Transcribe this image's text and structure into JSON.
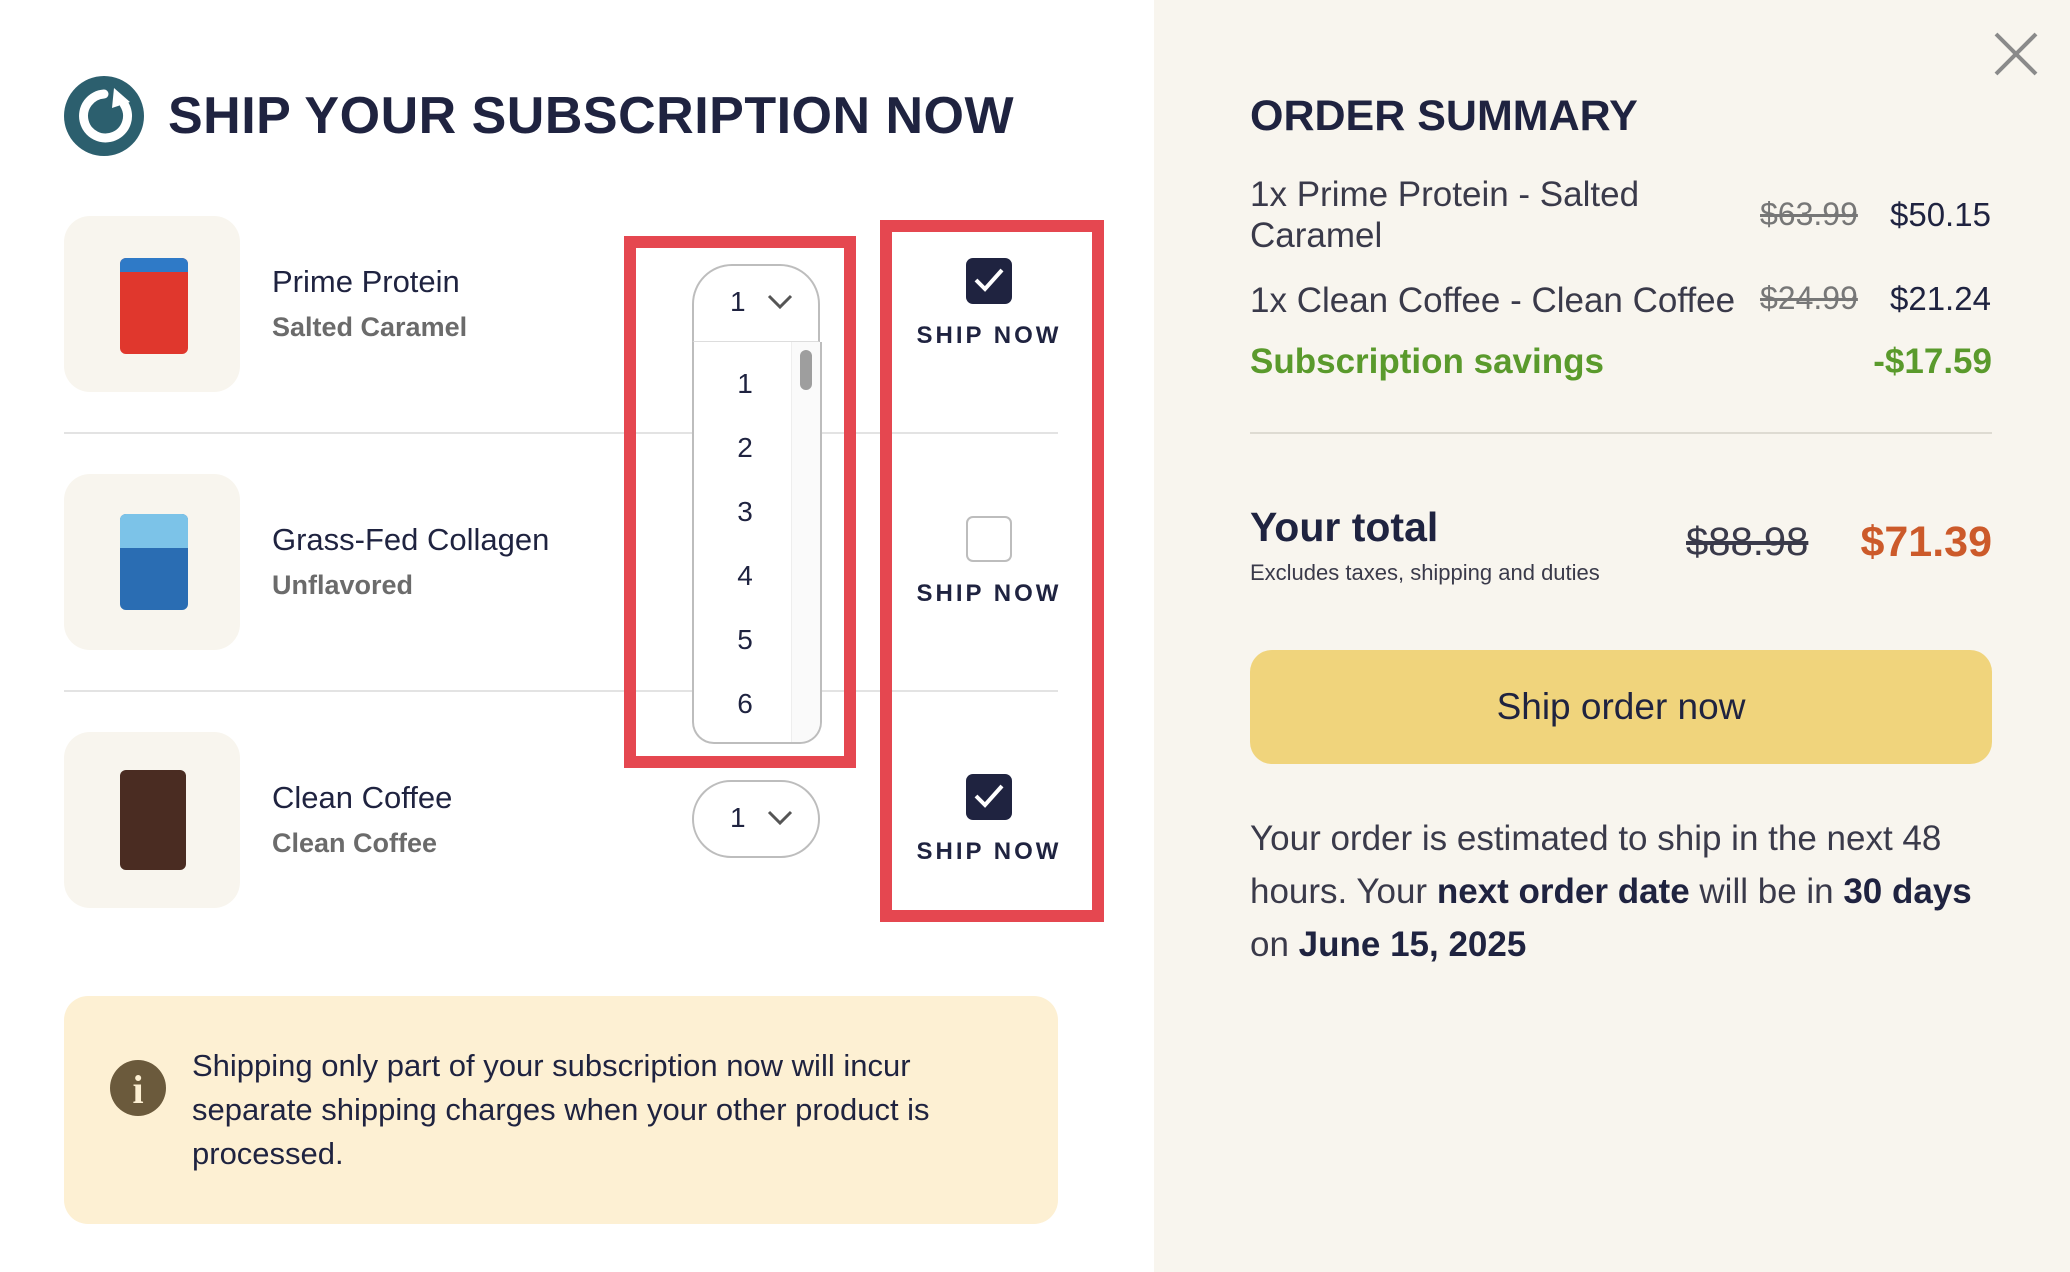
{
  "left": {
    "title": "SHIP YOUR SUBSCRIPTION NOW",
    "items": [
      {
        "name": "Prime Protein",
        "variant": "Salted Caramel",
        "qty": "1",
        "ship_now_label": "SHIP NOW",
        "checked": true,
        "pkg_color": "#e0372d"
      },
      {
        "name": "Grass-Fed Collagen",
        "variant": "Unflavored",
        "qty": "1",
        "ship_now_label": "SHIP NOW",
        "checked": false,
        "pkg_color": "#2a6db3"
      },
      {
        "name": "Clean Coffee",
        "variant": "Clean Coffee",
        "qty": "1",
        "ship_now_label": "SHIP NOW",
        "checked": true,
        "pkg_color": "#4a2c22"
      }
    ],
    "qty_dropdown": {
      "options": [
        "1",
        "2",
        "3",
        "4",
        "5",
        "6"
      ]
    },
    "notice": {
      "text": "Shipping only part of your subscription now will incur separate shipping charges when your other product is processed.",
      "icon": "info-icon"
    }
  },
  "summary": {
    "title": "ORDER SUMMARY",
    "lines": [
      {
        "name": "1x Prime Protein - Salted Caramel",
        "old_price": "$63.99",
        "price": "$50.15"
      },
      {
        "name": "1x Clean Coffee - Clean Coffee",
        "old_price": "$24.99",
        "price": "$21.24"
      }
    ],
    "savings_label": "Subscription savings",
    "savings_amount": "-$17.59",
    "total_label": "Your total",
    "total_sub": "Excludes taxes, shipping and duties",
    "total_old": "$88.98",
    "total_new": "$71.39",
    "button_label": "Ship order now",
    "eta": {
      "p1": "Your order is estimated to ship in the next 48 hours. Your ",
      "b1": "next order date",
      "p2": " will be in ",
      "b2": "30 days",
      "p3": " on ",
      "b3": "June 15, 2025"
    }
  },
  "colors": {
    "accent_dark": "#1f2340",
    "highlight": "#e54750",
    "button": "#f0d47c",
    "savings": "#5a9a2c",
    "total": "#cc5a2a",
    "summary_bg": "#f8f5ee",
    "notice_bg": "#fdf0d3"
  }
}
